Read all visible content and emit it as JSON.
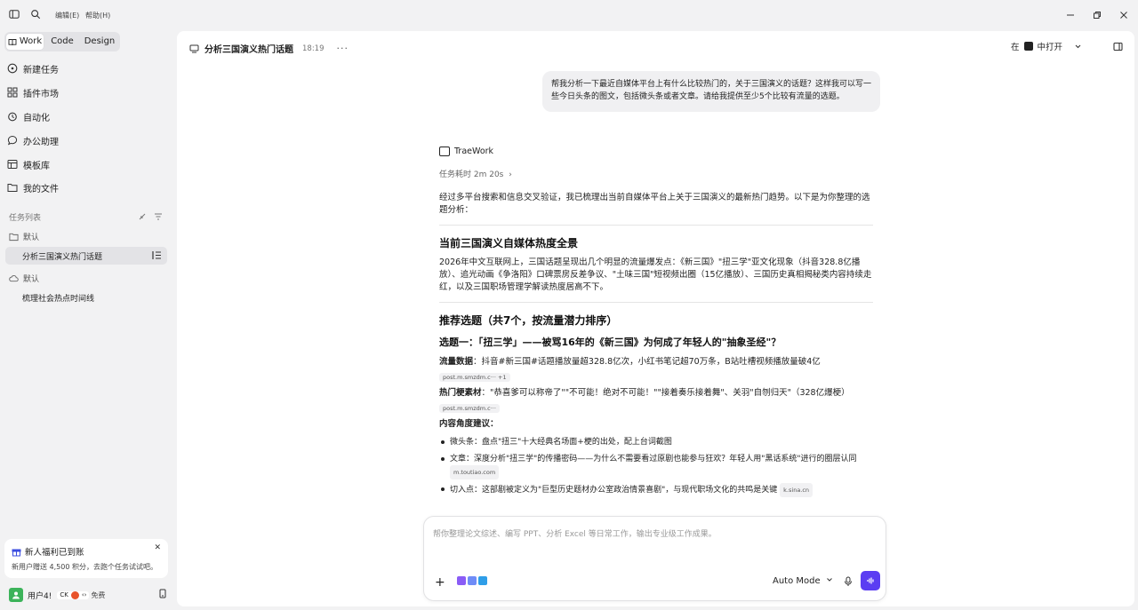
{
  "titlebar": {
    "menu_edit": "编辑(E)",
    "menu_help": "帮助(H)"
  },
  "sidebar": {
    "modes": [
      "Work",
      "Code",
      "Design"
    ],
    "active_mode": "Work",
    "nav": [
      {
        "label": "新建任务",
        "icon": "plus-circle-icon"
      },
      {
        "label": "插件市场",
        "icon": "grid-icon"
      },
      {
        "label": "自动化",
        "icon": "alarm-clock-icon"
      },
      {
        "label": "办公助理",
        "icon": "chat-bubble-icon"
      },
      {
        "label": "模板库",
        "icon": "template-icon"
      },
      {
        "label": "我的文件",
        "icon": "folder-icon"
      }
    ],
    "task_list_label": "任务列表",
    "groups": [
      {
        "name": "默认",
        "icon": "folder-icon",
        "tasks": [
          "分析三国演义热门话题"
        ]
      },
      {
        "name": "默认",
        "icon": "cloud-icon",
        "tasks": [
          "梳理社会热点时间线"
        ]
      }
    ],
    "active_task": "分析三国演义热门话题",
    "promo": {
      "title": "新人福利已到账",
      "subtitle": "新用户赠送 4,500 积分，去跑个任务试试吧。"
    },
    "user": {
      "name": "用户4!",
      "badge": "免费",
      "tray_text": "CK"
    }
  },
  "header": {
    "title": "分析三国演义热门话题",
    "time": "18:19",
    "more": "···",
    "open_in_prefix": "在",
    "open_in_label": "中打开"
  },
  "conversation": {
    "user_message": "帮我分析一下最近自媒体平台上有什么比较热门的，关于三国演义的话题？这样我可以写一些今日头条的图文，包括微头条或者文章。请给我提供至少5个比较有流量的选题。",
    "agent_name": "TraeWork",
    "duration": "任务耗时 2m 20s",
    "intro": "经过多平台搜索和信息交叉验证，我已梳理出当前自媒体平台上关于三国演义的最新热门趋势。以下是为你整理的选题分析：",
    "section1_title": "当前三国演义自媒体热度全景",
    "section1_body": "2026年中文互联网上，三国话题呈现出几个明显的流量爆发点：《新三国》\"扭三学\"亚文化现象（抖音328.8亿播放）、追光动画《争洛阳》口碑票房反差争议、\"土味三国\"短视频出圈（15亿播放）、三国历史真相揭秘类内容持续走红，以及三国职场管理学解读热度居高不下。",
    "section2_title": "推荐选题（共7个，按流量潜力排序）",
    "topic1_title": "选题一：「扭三学」——被骂16年的《新三国》为何成了年轻人的\"抽象圣经\"？",
    "traffic_label": "流量数据",
    "traffic_text": "：抖音#新三国#话题播放量超328.8亿次，小红书笔记超70万条，B站吐槽视频播放量破4亿",
    "cite1": "post.m.smzdm.c···",
    "cite1_more": "+1",
    "meme_label": "热门梗素材",
    "meme_text": "：\"恭喜爹可以称帝了\"\"不可能！绝对不可能！\"\"接着奏乐接着舞\"、关羽\"自刎归天\"（328亿爆梗）",
    "cite2": "post.m.smzdm.c···",
    "angle_label": "内容角度建议",
    "angle_colon": "：",
    "bullets": [
      {
        "text": "微头条：盘点\"扭三\"十大经典名场面+梗的出处，配上台词截图",
        "cite": ""
      },
      {
        "text": "文章：深度分析\"扭三学\"的传播密码——为什么不需要看过原剧也能参与狂欢？年轻人用\"黑话系统\"进行的圈层认同",
        "cite": "m.toutiao.com"
      },
      {
        "text": "切入点：这部剧被定义为\"巨型历史题材办公室政治情景喜剧\"，与现代职场文化的共鸣是关键",
        "cite": "k.sina.cn"
      }
    ]
  },
  "composer": {
    "placeholder": "帮你整理论文综述、编写 PPT、分析 Excel 等日常工作，输出专业级工作成果。",
    "mode": "Auto Mode",
    "accent": "#5b3df2"
  }
}
